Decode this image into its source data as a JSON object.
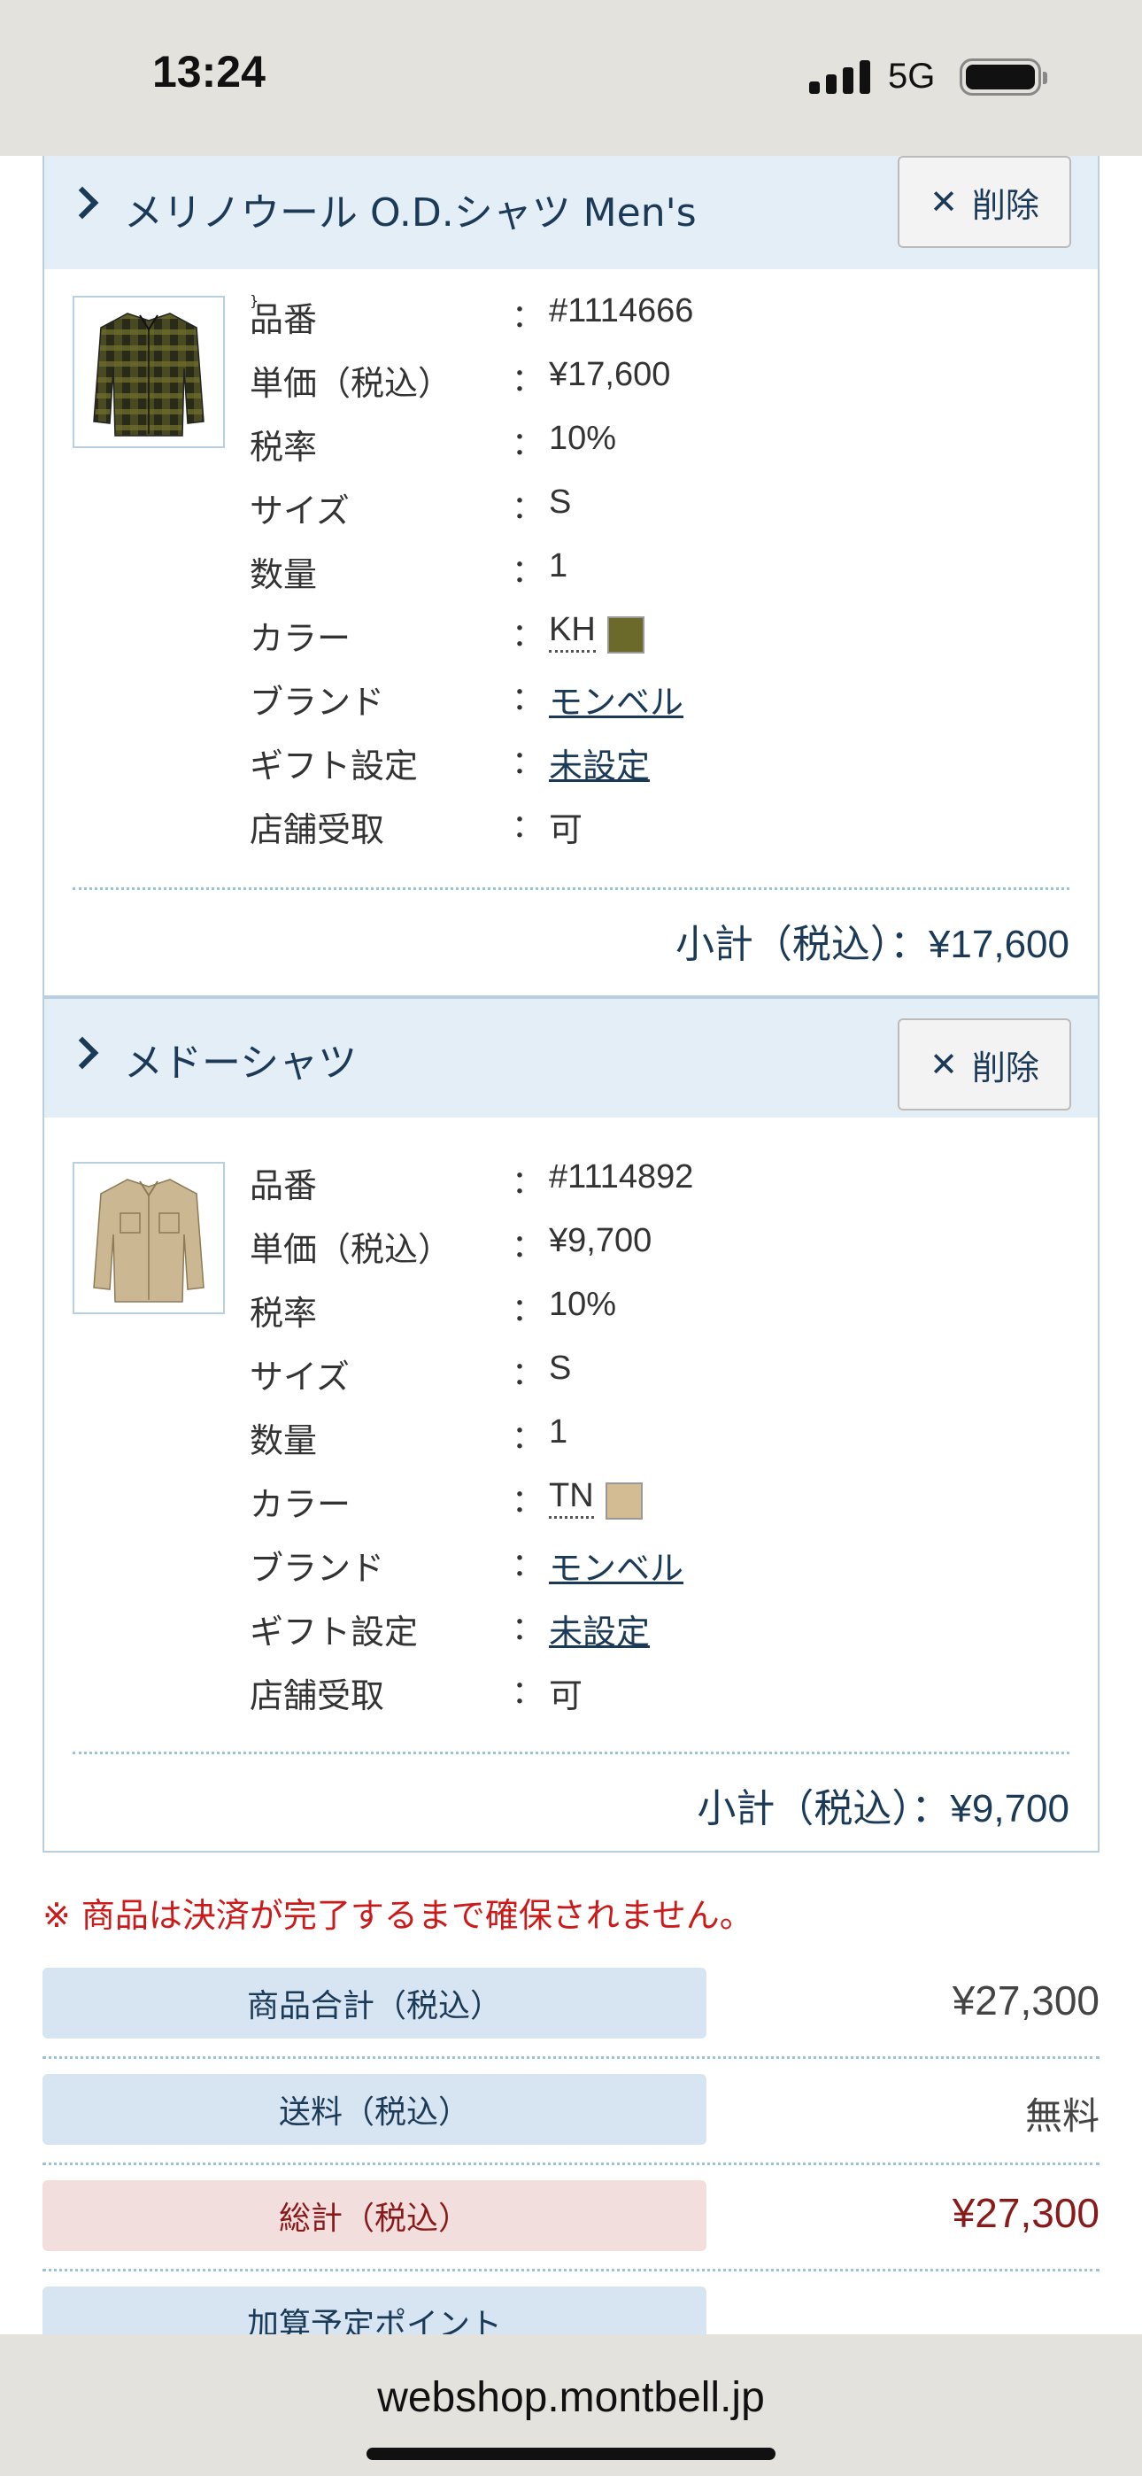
{
  "status_bar": {
    "time": "13:24",
    "network": "5G",
    "icons": [
      "signal-bars-icon",
      "battery-icon"
    ]
  },
  "items": [
    {
      "name": "メリノウール O.D.シャツ Men's",
      "delete_label": "削除",
      "image": "checked-flannel-shirt",
      "specs": {
        "product_code": {
          "label": "品番",
          "value": "#1114666"
        },
        "unit_price": {
          "label": "単価（税込）",
          "value": "¥17,600"
        },
        "tax_rate": {
          "label": "税率",
          "value": "10%"
        },
        "size": {
          "label": "サイズ",
          "value": "S"
        },
        "quantity": {
          "label": "数量",
          "value": "1"
        },
        "color": {
          "label": "カラー",
          "value": "KH",
          "swatch": "#6b6a2a"
        },
        "brand": {
          "label": "ブランド",
          "value": "モンベル"
        },
        "gift": {
          "label": "ギフト設定",
          "value": "未設定"
        },
        "pickup": {
          "label": "店舗受取",
          "value": "可"
        }
      },
      "colon": "：",
      "subtotal_label": "小計（税込）",
      "subtotal_value": "：¥17,600"
    },
    {
      "name": "メドーシャツ",
      "delete_label": "削除",
      "image": "khaki-shirt",
      "specs": {
        "product_code": {
          "label": "品番",
          "value": "#1114892"
        },
        "unit_price": {
          "label": "単価（税込）",
          "value": "¥9,700"
        },
        "tax_rate": {
          "label": "税率",
          "value": "10%"
        },
        "size": {
          "label": "サイズ",
          "value": "S"
        },
        "quantity": {
          "label": "数量",
          "value": "1"
        },
        "color": {
          "label": "カラー",
          "value": "TN",
          "swatch": "#d3bc93"
        },
        "brand": {
          "label": "ブランド",
          "value": "モンベル"
        },
        "gift": {
          "label": "ギフト設定",
          "value": "未設定"
        },
        "pickup": {
          "label": "店舗受取",
          "value": "可"
        }
      },
      "colon": "：",
      "subtotal_label": "小計（税込）",
      "subtotal_value": "：¥9,700"
    }
  ],
  "notice": "※ 商品は決済が完了するまで確保されません。",
  "totals": {
    "merchandise": {
      "label": "商品合計（税込）",
      "value": "¥27,300"
    },
    "shipping": {
      "label": "送料（税込）",
      "value": "無料"
    },
    "grand_total": {
      "label": "総計（税込）",
      "value": "¥27,300"
    },
    "points": {
      "label": "加算予定ポイント",
      "value": ""
    }
  },
  "browser": {
    "url": "webshop.montbell.jp"
  },
  "colors": {
    "accent_navy": "#1b3a57",
    "header_bg": "#e4eef6",
    "notice_red": "#cc1a1a",
    "total_red": "#8a1a1a"
  }
}
